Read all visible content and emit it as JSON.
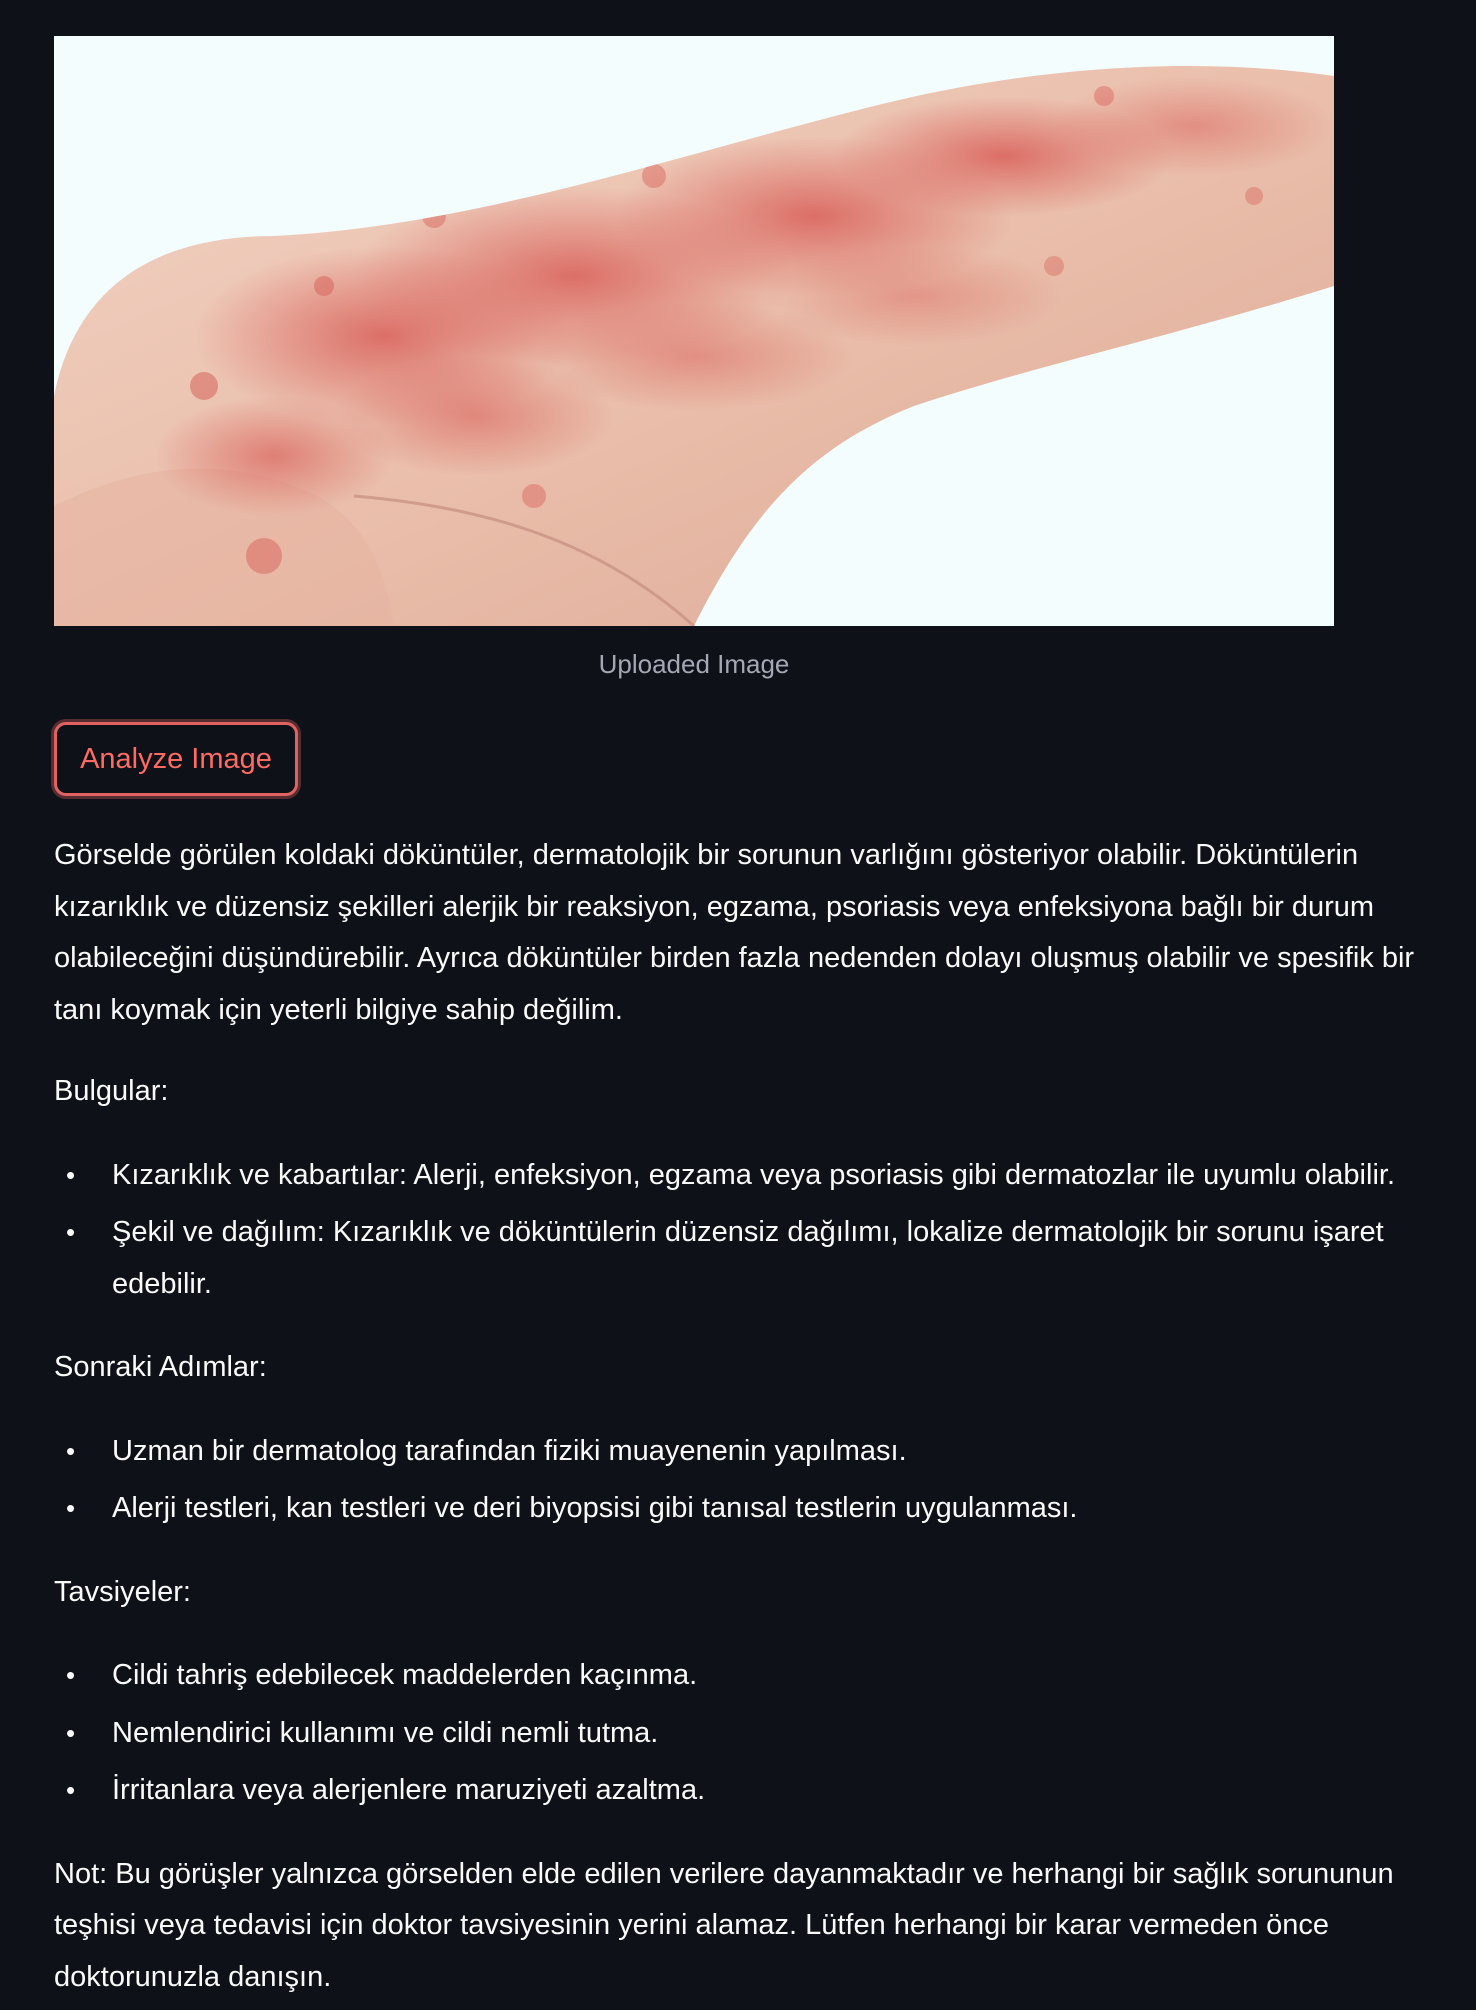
{
  "uploaded_image": {
    "caption": "Uploaded Image",
    "icon": "rash-arm-photo"
  },
  "analyze_button": {
    "label": "Analyze Image"
  },
  "result": {
    "intro": "Görselde görülen koldaki döküntüler, dermatolojik bir sorunun varlığını gösteriyor olabilir. Döküntülerin kızarıklık ve düzensiz şekilleri alerjik bir reaksiyon, egzama, psoriasis veya enfeksiyona bağlı bir durum olabileceğini düşündürebilir. Ayrıca döküntüler birden fazla nedenden dolayı oluşmuş olabilir ve spesifik bir tanı koymak için yeterli bilgiye sahip değilim.",
    "findings_heading": "Bulgular:",
    "findings": [
      "Kızarıklık ve kabartılar: Alerji, enfeksiyon, egzama veya psoriasis gibi dermatozlar ile uyumlu olabilir.",
      "Şekil ve dağılım: Kızarıklık ve döküntülerin düzensiz dağılımı, lokalize dermatolojik bir sorunu işaret edebilir."
    ],
    "next_steps_heading": "Sonraki Adımlar:",
    "next_steps": [
      "Uzman bir dermatolog tarafından fiziki muayenenin yapılması.",
      "Alerji testleri, kan testleri ve deri biyopsisi gibi tanısal testlerin uygulanması."
    ],
    "recommendations_heading": "Tavsiyeler:",
    "recommendations": [
      "Cildi tahriş edebilecek maddelerden kaçınma.",
      "Nemlendirici kullanımı ve cildi nemli tutma.",
      "İrritanlara veya alerjenlere maruziyeti azaltma."
    ],
    "note": "Not: Bu görüşler yalnızca görselden elde edilen verilere dayanmaktadır ve herhangi bir sağlık sorununun teşhisi veya tedavisi için doktor tavsiyesinin yerini alamaz. Lütfen herhangi bir karar vermeden önce doktorunuzla danışın."
  },
  "colors": {
    "background": "#0e1117",
    "text": "#fafafa",
    "caption": "#a3a8b4",
    "button_accent": "#ff6b62"
  }
}
